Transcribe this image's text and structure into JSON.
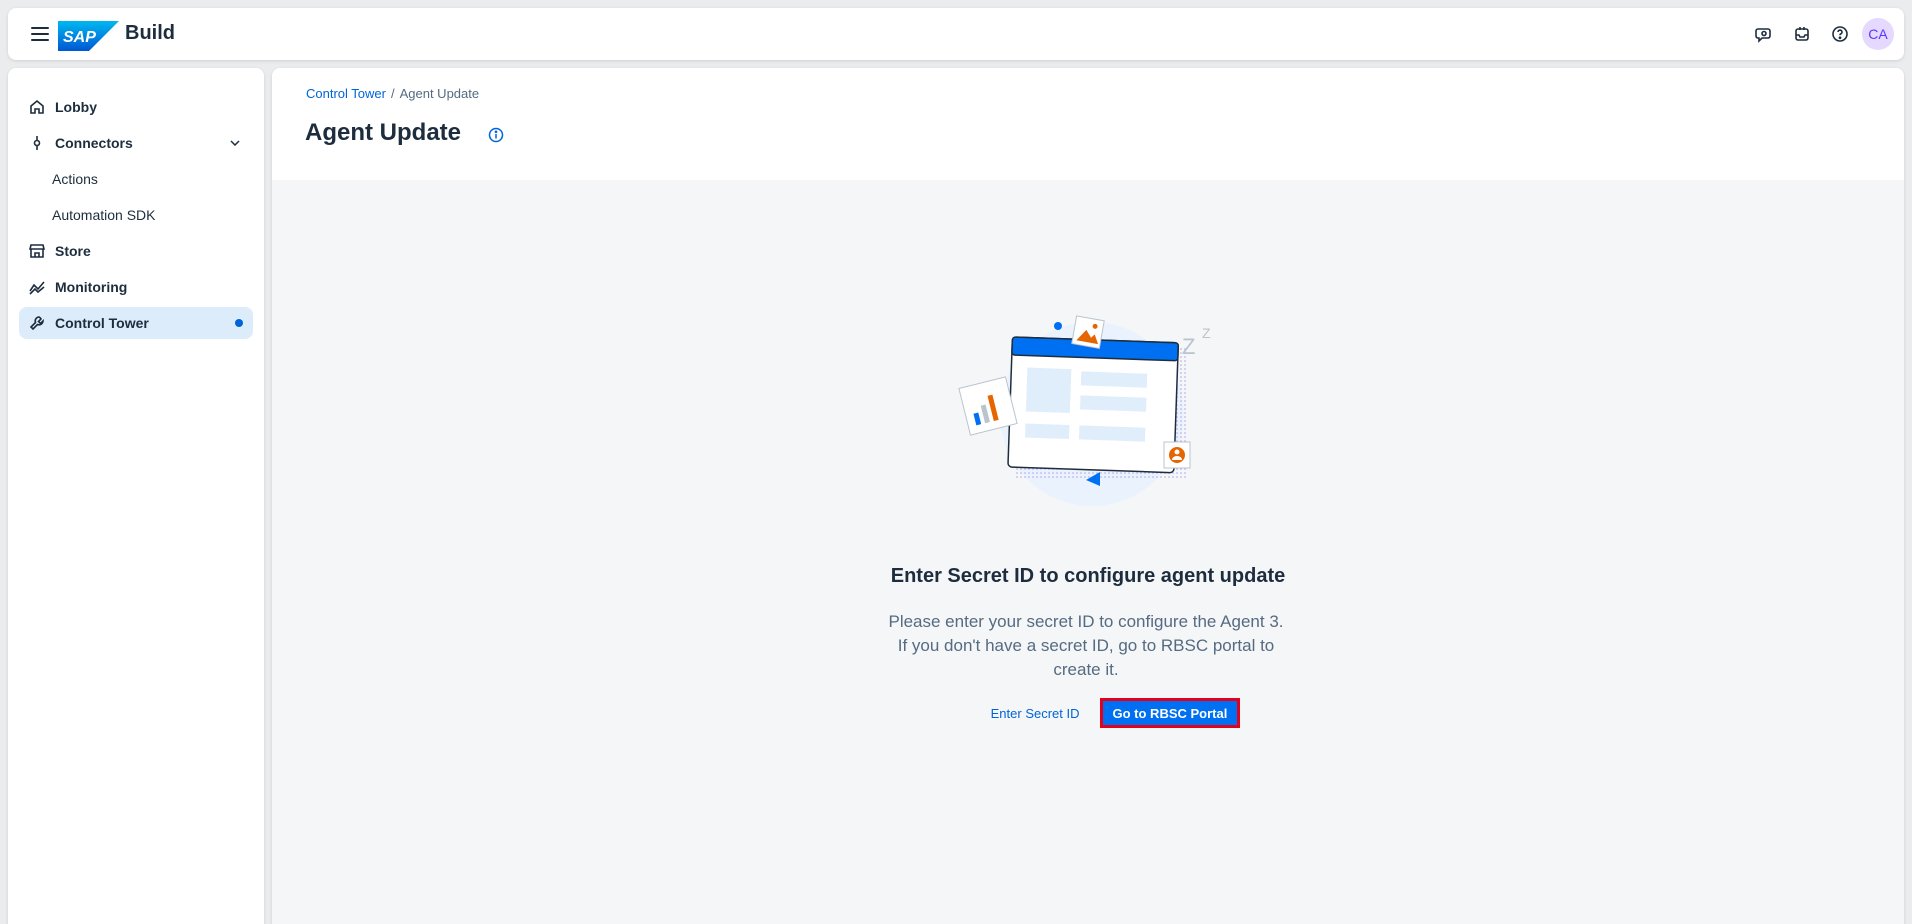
{
  "shell": {
    "product": "Build",
    "logo_text": "SAP",
    "avatar_initials": "CA",
    "icons": [
      "menu-icon",
      "joule-icon",
      "inbox-icon",
      "help-icon"
    ]
  },
  "sidebar": {
    "items": [
      {
        "label": "Lobby",
        "icon": "home-icon"
      },
      {
        "label": "Connectors",
        "icon": "connector-icon"
      },
      {
        "label": "Actions"
      },
      {
        "label": "Automation SDK"
      },
      {
        "label": "Store",
        "icon": "store-icon"
      },
      {
        "label": "Monitoring",
        "icon": "line-chart-icon"
      },
      {
        "label": "Control Tower",
        "icon": "wrench-icon",
        "selected": true
      }
    ]
  },
  "breadcrumb": {
    "parent": "Control Tower",
    "separator": "/",
    "current": "Agent Update"
  },
  "page": {
    "title": "Agent Update"
  },
  "empty_state": {
    "title": "Enter Secret ID to configure agent update",
    "description": "Please enter your secret ID to configure the Agent 3. If you don't have a secret ID, go to RBSC portal to create it.",
    "secondary_action": "Enter Secret ID",
    "primary_action": "Go to RBSC Portal"
  },
  "colors": {
    "accent": "#0070f2",
    "link": "#0064d9",
    "selected_nav": "#dcecfb",
    "highlight_border": "#e3001b"
  }
}
